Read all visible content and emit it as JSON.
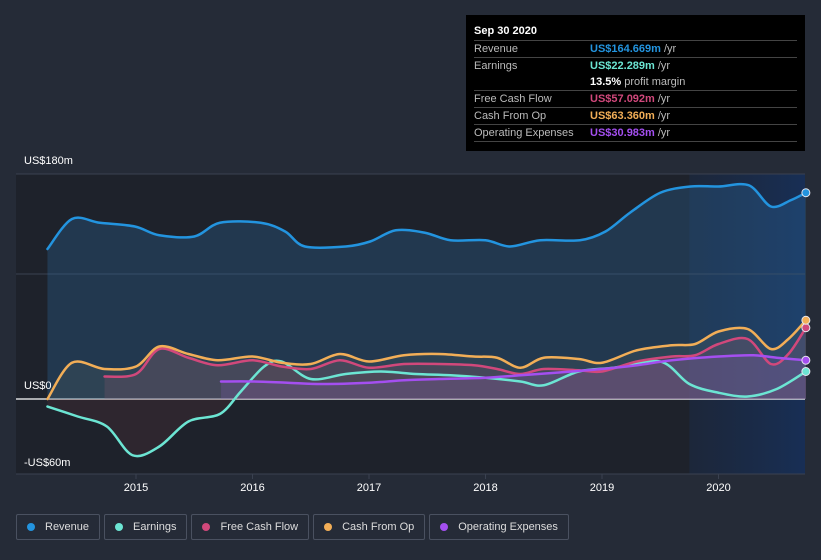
{
  "tooltip": {
    "date": "Sep 30 2020",
    "rows": [
      {
        "label": "Revenue",
        "value": "US$164.669m",
        "unit": "/yr",
        "color": "#2394df"
      },
      {
        "label": "Earnings",
        "value": "US$22.289m",
        "unit": "/yr",
        "color": "#6ce5d3"
      },
      {
        "label": "",
        "value": "13.5%",
        "unit": "profit margin",
        "color": "#ffffff"
      },
      {
        "label": "Free Cash Flow",
        "value": "US$57.092m",
        "unit": "/yr",
        "color": "#d1487b"
      },
      {
        "label": "Cash From Op",
        "value": "US$63.360m",
        "unit": "/yr",
        "color": "#f2ae57"
      },
      {
        "label": "Operating Expenses",
        "value": "US$30.983m",
        "unit": "/yr",
        "color": "#a44ff0"
      }
    ]
  },
  "legend": [
    {
      "label": "Revenue",
      "color": "#2394df"
    },
    {
      "label": "Earnings",
      "color": "#6ce5d3"
    },
    {
      "label": "Free Cash Flow",
      "color": "#d1487b"
    },
    {
      "label": "Cash From Op",
      "color": "#f2ae57"
    },
    {
      "label": "Operating Expenses",
      "color": "#a44ff0"
    }
  ],
  "chart_data": {
    "type": "area",
    "title": "",
    "xlabel": "",
    "ylabel": "",
    "ylim": [
      -60,
      180
    ],
    "xlim": [
      2014.24,
      2020.75
    ],
    "y_tick_labels": [
      {
        "value": 180,
        "label": "US$180m"
      },
      {
        "value": 0,
        "label": "US$0"
      },
      {
        "value": -60,
        "label": "-US$60m"
      }
    ],
    "x_tick_labels": [
      {
        "value": 2015,
        "label": "2015"
      },
      {
        "value": 2016,
        "label": "2016"
      },
      {
        "value": 2017,
        "label": "2017"
      },
      {
        "value": 2018,
        "label": "2018"
      },
      {
        "value": 2019,
        "label": "2019"
      },
      {
        "value": 2020,
        "label": "2020"
      }
    ],
    "highlight_from": 2019.75,
    "grid": true,
    "legend_position": "bottom",
    "series": [
      {
        "name": "Revenue",
        "color": "#2394df",
        "x": [
          2014.24,
          2014.45,
          2014.69,
          2014.99,
          2015.2,
          2015.5,
          2015.72,
          2016.07,
          2016.28,
          2016.45,
          2016.8,
          2017.01,
          2017.23,
          2017.48,
          2017.7,
          2018.0,
          2018.21,
          2018.47,
          2018.81,
          2019.03,
          2019.24,
          2019.5,
          2019.76,
          2020.0,
          2020.26,
          2020.45,
          2020.62,
          2020.75
        ],
        "values": [
          120,
          144,
          141,
          138,
          131,
          130,
          141,
          141,
          134,
          122,
          122,
          126,
          135,
          133,
          127,
          127,
          122,
          127,
          127,
          134,
          149,
          165,
          170,
          170,
          171,
          154,
          159,
          165
        ]
      },
      {
        "name": "Earnings",
        "color": "#6ce5d3",
        "x": [
          2014.24,
          2014.5,
          2014.75,
          2014.97,
          2015.2,
          2015.45,
          2015.72,
          2015.9,
          2016.1,
          2016.25,
          2016.5,
          2016.8,
          2017.1,
          2017.4,
          2017.7,
          2018.0,
          2018.3,
          2018.5,
          2018.8,
          2019.1,
          2019.5,
          2019.75,
          2020.0,
          2020.25,
          2020.5,
          2020.75
        ],
        "values": [
          -6,
          -14,
          -22,
          -45,
          -38,
          -18,
          -12,
          6,
          26,
          30,
          16,
          20,
          22,
          20,
          19,
          17,
          14,
          11,
          22,
          25,
          30,
          12,
          5,
          2,
          8,
          22
        ]
      },
      {
        "name": "Free Cash Flow",
        "color": "#d1487b",
        "x": [
          2014.73,
          2015.0,
          2015.2,
          2015.45,
          2015.7,
          2016.0,
          2016.25,
          2016.5,
          2016.75,
          2017.0,
          2017.3,
          2017.6,
          2017.9,
          2018.1,
          2018.3,
          2018.5,
          2018.8,
          2019.0,
          2019.3,
          2019.6,
          2019.8,
          2020.0,
          2020.25,
          2020.45,
          2020.6,
          2020.75
        ],
        "values": [
          18,
          20,
          40,
          33,
          27,
          31,
          26,
          24,
          31,
          25,
          28,
          28,
          27,
          24,
          20,
          24,
          23,
          22,
          30,
          34,
          35,
          44,
          48,
          28,
          36,
          57
        ]
      },
      {
        "name": "Cash From Op",
        "color": "#f2ae57",
        "x": [
          2014.24,
          2014.45,
          2014.73,
          2015.0,
          2015.2,
          2015.45,
          2015.7,
          2016.0,
          2016.25,
          2016.5,
          2016.75,
          2017.0,
          2017.3,
          2017.6,
          2017.9,
          2018.1,
          2018.3,
          2018.5,
          2018.8,
          2019.0,
          2019.3,
          2019.6,
          2019.8,
          2020.0,
          2020.25,
          2020.45,
          2020.6,
          2020.75
        ],
        "values": [
          0,
          29,
          24,
          26,
          42,
          36,
          31,
          34,
          29,
          28,
          36,
          30,
          35,
          36,
          34,
          33,
          25,
          33,
          32,
          29,
          39,
          43,
          44,
          54,
          56,
          40,
          48,
          63
        ]
      },
      {
        "name": "Operating Expenses",
        "color": "#a44ff0",
        "x": [
          2015.73,
          2016.0,
          2016.3,
          2016.6,
          2017.0,
          2017.3,
          2017.6,
          2018.0,
          2018.3,
          2018.6,
          2019.0,
          2019.3,
          2019.6,
          2020.0,
          2020.3,
          2020.5,
          2020.75
        ],
        "values": [
          14,
          14,
          13,
          12,
          13,
          15,
          16,
          17,
          19,
          21,
          24,
          27,
          31,
          34,
          35,
          33,
          31
        ]
      }
    ]
  }
}
